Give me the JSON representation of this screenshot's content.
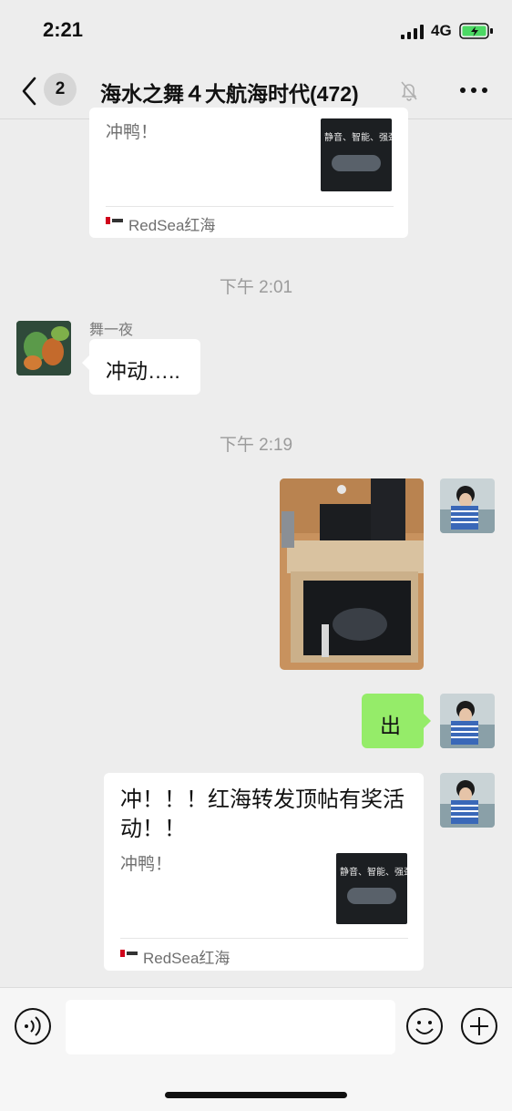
{
  "status": {
    "time": "2:21",
    "network": "4G",
    "battery_color": "#4cd964"
  },
  "nav": {
    "unread_count": "2",
    "title": "海水之舞４大航海时代(472)"
  },
  "messages": {
    "card_top": {
      "subtitle": "冲鸭！",
      "thumb_text": "静音、智能、强劲",
      "source": "RedSea红海"
    },
    "time1": "下午 2:01",
    "msg_in": {
      "sender": "舞一夜",
      "text": "冲动….."
    },
    "time2": "下午 2:19",
    "msg_out": {
      "text": "出"
    },
    "card_bottom": {
      "title": "冲！！！红海转发顶帖有奖活动！！",
      "subtitle": "冲鸭！",
      "thumb_text": "静音、智能、强劲",
      "source": "RedSea红海"
    }
  },
  "icons": {
    "back": "chevron-left-icon",
    "mute": "bell-slash-icon",
    "more": "more-dots-icon",
    "voice": "voice-icon",
    "emoji": "emoji-icon",
    "plus": "plus-circle-icon"
  },
  "colors": {
    "bubble_out": "#95ec69",
    "background": "#ededed"
  }
}
